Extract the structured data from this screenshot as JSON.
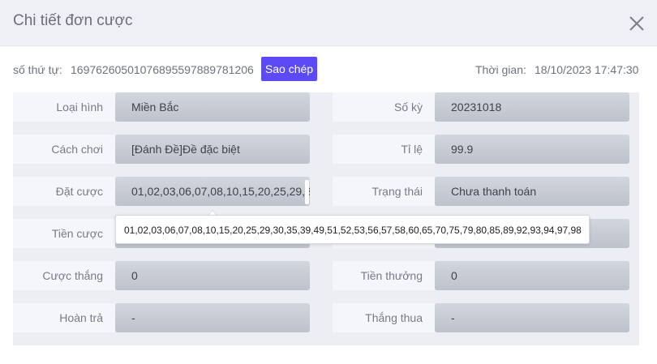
{
  "dialog": {
    "title": "Chi tiết đơn cược",
    "close_icon": "close-icon"
  },
  "info": {
    "order_label": "số thứ tự:",
    "order_number": "169762605010768955978897812​06",
    "copy_button": "Sao chép",
    "time_label": "Thời gian:",
    "time_value": "18/10/2023 17:47:30"
  },
  "fields": {
    "type": {
      "label": "Loại hình",
      "value": "Miền Bắc"
    },
    "period": {
      "label": "Số kỳ",
      "value": "20231018"
    },
    "play": {
      "label": "Cách chơi",
      "value": "[Đánh Đề]Đề đặc biệt"
    },
    "odds": {
      "label": "Tỉ lệ",
      "value": "99.9"
    },
    "bet": {
      "label": "Đặt cược",
      "value": "01,02,03,06,07,08,10,15,20,25,29,30,35,39,49,51,52,53,56,57,58,60,65,70,75,79,80,85,89,92,93,94,97,98"
    },
    "status": {
      "label": "Trạng thái",
      "value": "Chưa thanh toán"
    },
    "stake": {
      "label": "Tiền cược",
      "value": ""
    },
    "stake_right": {
      "label": "",
      "value": ""
    },
    "win_bet": {
      "label": "Cược thắng",
      "value": "0"
    },
    "prize": {
      "label": "Tiền thưởng",
      "value": "0"
    },
    "refund": {
      "label": "Hoàn trả",
      "value": "-"
    },
    "result": {
      "label": "Thắng thua",
      "value": "-"
    }
  },
  "tooltip": {
    "text": "01,02,03,06,07,08,10,15,20,25,29,30,35,39,49,51,52,53,56,57,58,60,65,70,75,79,80,85,89,92,93,94,97,98"
  },
  "colors": {
    "accent": "#5c4bf5",
    "header_bg": "#eef0f5",
    "value_bg": "#c7cbd4"
  }
}
